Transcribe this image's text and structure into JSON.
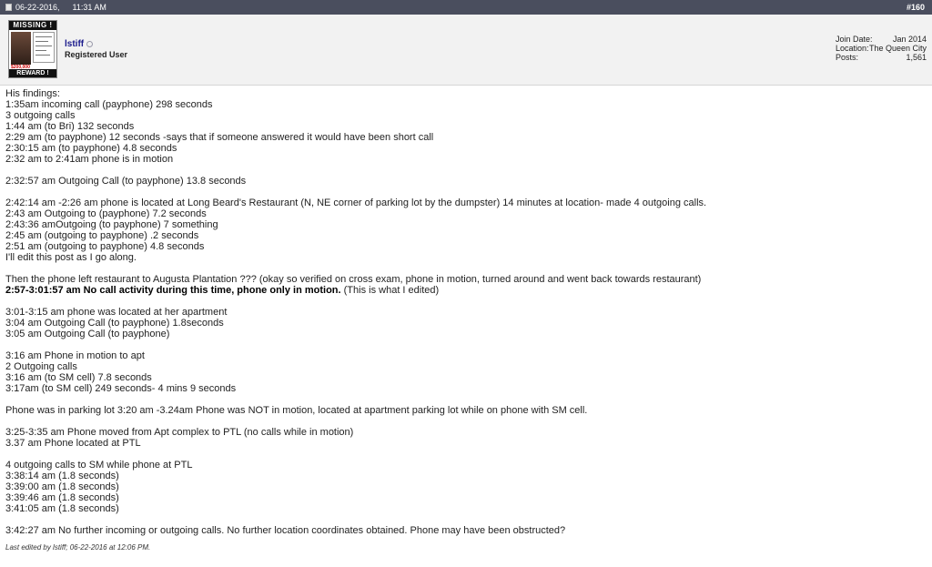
{
  "post": {
    "date": "06-22-2016,",
    "time": "11:31 AM",
    "number": "#160"
  },
  "user": {
    "name": "lstiff",
    "title": "Registered User",
    "avatar": {
      "top_text": "MISSING !",
      "amount_text": "$200,000",
      "bottom_text": "REWARD !"
    },
    "info": [
      {
        "label": "Join Date:",
        "value": "Jan 2014"
      },
      {
        "label": "Location:",
        "value": "The Queen City"
      },
      {
        "label": "Posts:",
        "value": "1,561"
      }
    ]
  },
  "content": {
    "l01": "His findings:",
    "l02": "1:35am incoming call (payphone) 298 seconds",
    "l03": "3 outgoing calls",
    "l04": "1:44 am (to Bri) 132 seconds",
    "l05": "2:29 am (to payphone) 12 seconds -says that if someone answered it would have been short call",
    "l06": "2:30:15 am (to payphone) 4.8 seconds",
    "l07": "2:32 am to 2:41am phone is in motion",
    "l08": "2:32:57 am Outgoing Call (to payphone) 13.8 seconds",
    "l09": "2:42:14 am -2:26 am phone is located at Long Beard's Restaurant (N, NE corner of parking lot by the dumpster) 14 minutes at location- made 4 outgoing calls.",
    "l10": "2:43 am Outgoing to (payphone) 7.2 seconds",
    "l11": "2:43:36 amOutgoing (to payphone) 7 something",
    "l12": "2:45 am (outgoing to payphone) .2 seconds",
    "l13": "2:51 am (outgoing to payphone) 4.8 seconds",
    "l14": "I'll edit this post as I go along.",
    "l15": "Then the phone left restaurant to Augusta Plantation ??? (okay so verified on cross exam, phone in motion, turned around and went back towards restaurant)",
    "l16_bold": "2:57-3:01:57 am No call activity during this time, phone only in motion.",
    "l16_rest": " (This is what I edited)",
    "l17": "3:01-3:15 am phone was located at her apartment",
    "l18": "3:04 am Outgoing Call (to payphone) 1.8seconds",
    "l19": "3:05 am Outgoing Call (to payphone)",
    "l20": "3:16 am Phone in motion to apt",
    "l21": "2 Outgoing calls",
    "l22": "3:16 am (to SM cell) 7.8 seconds",
    "l23": "3:17am (to SM cell) 249 seconds- 4 mins 9 seconds",
    "l24": "Phone was in parking lot 3:20 am -3.24am Phone was NOT in motion, located at apartment parking lot while on phone with SM cell.",
    "l25": "3:25-3:35 am Phone moved from Apt complex to PTL (no calls while in motion)",
    "l26": "3.37 am Phone located at PTL",
    "l27": "4 outgoing calls to SM while phone at PTL",
    "l28": "3:38:14 am (1.8 seconds)",
    "l29": "3:39:00 am (1.8 seconds)",
    "l30": "3:39:46 am (1.8 seconds)",
    "l31": "3:41:05 am (1.8 seconds)",
    "l32": "3:42:27 am No further incoming or outgoing calls. No further location coordinates obtained. Phone may have been obstructed?"
  },
  "edit_note": "Last edited by lstiff; 06-22-2016 at 12:06 PM."
}
